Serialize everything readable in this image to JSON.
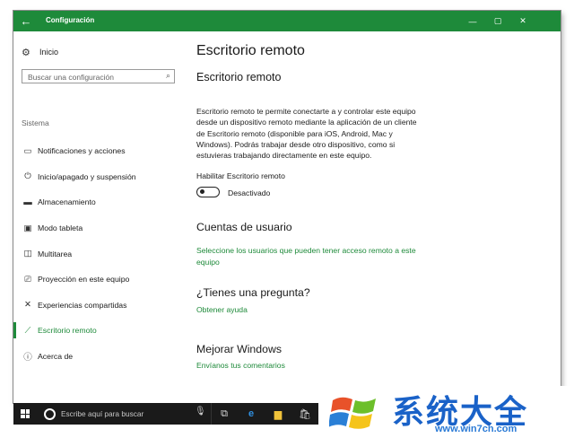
{
  "window": {
    "title": "Configuración",
    "back_glyph": "←",
    "minimize_glyph": "—",
    "maximize_glyph": "▢",
    "close_glyph": "✕",
    "accent_color": "#1e8a3a"
  },
  "sidebar": {
    "home_label": "Inicio",
    "search_placeholder": "Buscar una configuración",
    "section_label": "Sistema",
    "items": [
      {
        "icon": "monitor-icon",
        "glyph": "▭",
        "label": "Notificaciones y acciones"
      },
      {
        "icon": "power-icon",
        "glyph": "⏻",
        "label": "Inicio/apagado y suspensión"
      },
      {
        "icon": "storage-icon",
        "glyph": "▬",
        "label": "Almacenamiento"
      },
      {
        "icon": "tablet-icon",
        "glyph": "▣",
        "label": "Modo tableta"
      },
      {
        "icon": "multitask-icon",
        "glyph": "◫",
        "label": "Multitarea"
      },
      {
        "icon": "projection-icon",
        "glyph": "⎚",
        "label": "Proyección en este equipo"
      },
      {
        "icon": "shared-icon",
        "glyph": "✕",
        "label": "Experiencias compartidas"
      },
      {
        "icon": "remote-desktop-icon",
        "glyph": "⟋",
        "label": "Escritorio remoto",
        "active": true
      },
      {
        "icon": "info-icon",
        "glyph": "ⓘ",
        "label": "Acerca de"
      }
    ]
  },
  "main": {
    "page_title": "Escritorio remoto",
    "subtitle": "Escritorio remoto",
    "description": "Escritorio remoto te permite conectarte a y controlar este equipo desde un dispositivo remoto mediante la aplicación de un cliente de Escritorio remoto (disponible para iOS, Android, Mac y Windows). Podrás trabajar desde otro dispositivo, como si estuvieras trabajando directamente en este equipo.",
    "toggle_label": "Habilitar Escritorio remoto",
    "toggle_state": "Desactivado",
    "accounts_heading": "Cuentas de usuario",
    "accounts_link": "Seleccione los usuarios que pueden tener acceso remoto a este equipo",
    "question_heading": "¿Tienes una pregunta?",
    "help_link": "Obtener ayuda",
    "improve_heading": "Mejorar Windows",
    "feedback_link": "Envíanos tus comentarios"
  },
  "taskbar": {
    "search_text": "Escribe aquí para buscar"
  },
  "watermark": {
    "brand": "系统大全",
    "url": "www.win7cn.com"
  }
}
